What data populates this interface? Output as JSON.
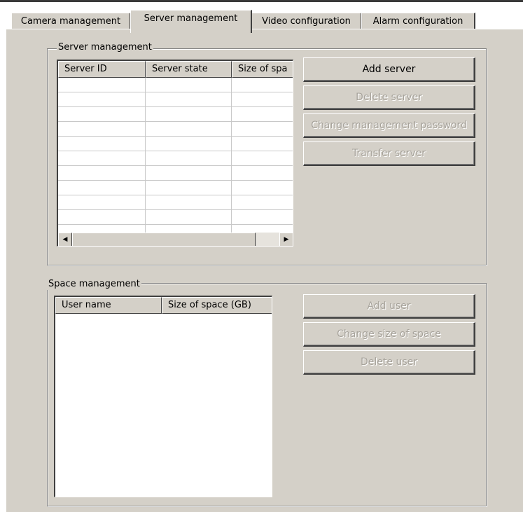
{
  "tabs": [
    {
      "label": "Camera management",
      "active": false
    },
    {
      "label": "Server management",
      "active": true
    },
    {
      "label": "Video configuration",
      "active": false
    },
    {
      "label": "Alarm configuration",
      "active": false
    }
  ],
  "server_group": {
    "title": "Server management",
    "columns": [
      "Server ID",
      "Server state",
      "Size of spa"
    ],
    "rows": [],
    "buttons": [
      {
        "label": "Add server",
        "enabled": true
      },
      {
        "label": "Delete server",
        "enabled": false
      },
      {
        "label": "Change management password",
        "enabled": false
      },
      {
        "label": "Transfer server",
        "enabled": false
      }
    ]
  },
  "space_group": {
    "title": "Space management",
    "columns": [
      "User name",
      "Size of space (GB)"
    ],
    "rows": [],
    "buttons": [
      {
        "label": "Add user",
        "enabled": false
      },
      {
        "label": "Change size of space",
        "enabled": false
      },
      {
        "label": "Delete user",
        "enabled": false
      }
    ]
  },
  "colors": {
    "face": "#d4d0c8",
    "disabled_text": "#a7a39b",
    "grid_line": "#c8c8c8"
  },
  "icons": {
    "scroll_left": "◀",
    "scroll_right": "▶"
  }
}
